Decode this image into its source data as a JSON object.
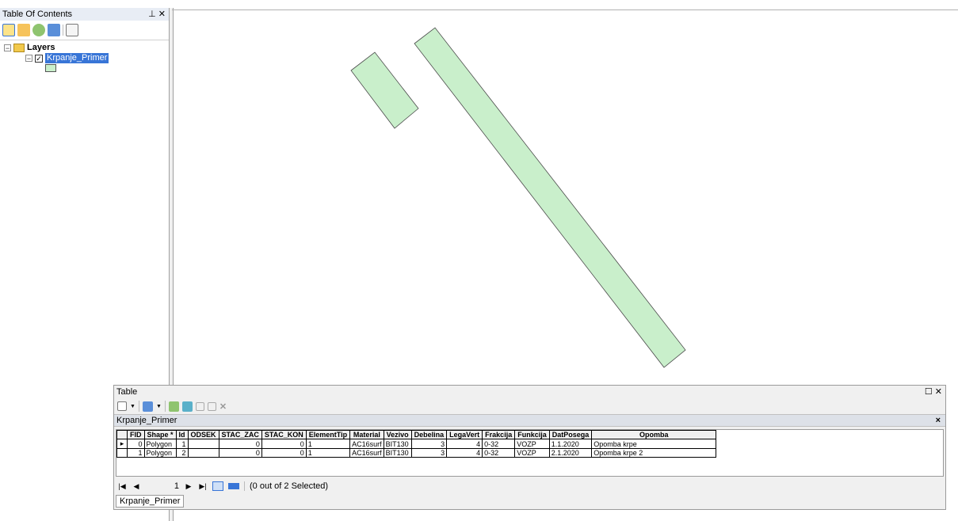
{
  "toc": {
    "title": "Table Of Contents",
    "pin_glyph": "Ȩ",
    "close_glyph": "✕",
    "toolbar_icons": [
      "list-by-drawing-order-icon",
      "list-by-source-icon",
      "list-by-visibility-icon",
      "list-by-selection-icon",
      "options-icon"
    ],
    "root_label": "Layers",
    "layer_label": "Krpanje_Primer",
    "layer_fill_color": "#c9efcb"
  },
  "map": {
    "polygon_fill": "#c9efcb",
    "polygon_stroke": "#4a4a4a"
  },
  "table": {
    "window_title": "Table",
    "maximize_glyph": "☐",
    "close_glyph": "✕",
    "layer_tab_title": "Krpanje_Primer",
    "layer_close_glyph": "×",
    "columns": [
      "FID",
      "Shape *",
      "Id",
      "ODSEK",
      "STAC_ZAC",
      "STAC_KON",
      "ElementTip",
      "Material",
      "Vezivo",
      "Debelina",
      "LegaVert",
      "Frakcija",
      "Funkcija",
      "DatPosega",
      "Opomba"
    ],
    "rows": [
      [
        "0",
        "Polygon",
        "1",
        "",
        "0",
        "0",
        "1",
        "AC16surf",
        "BIT130",
        "3",
        "4",
        "0-32",
        "VOZP",
        "1.1.2020",
        "Opomba krpe"
      ],
      [
        "1",
        "Polygon",
        "2",
        "",
        "0",
        "0",
        "1",
        "AC16surf",
        "BIT130",
        "3",
        "4",
        "0-32",
        "VOZP",
        "2.1.2020",
        "Opomba krpe 2"
      ]
    ],
    "nav": {
      "first": "⏮",
      "prev": "◀",
      "current_record": "1",
      "next": "▶",
      "last": "⏭",
      "selection_status": "(0 out of 2 Selected)"
    },
    "bottom_tab": "Krpanje_Primer"
  }
}
